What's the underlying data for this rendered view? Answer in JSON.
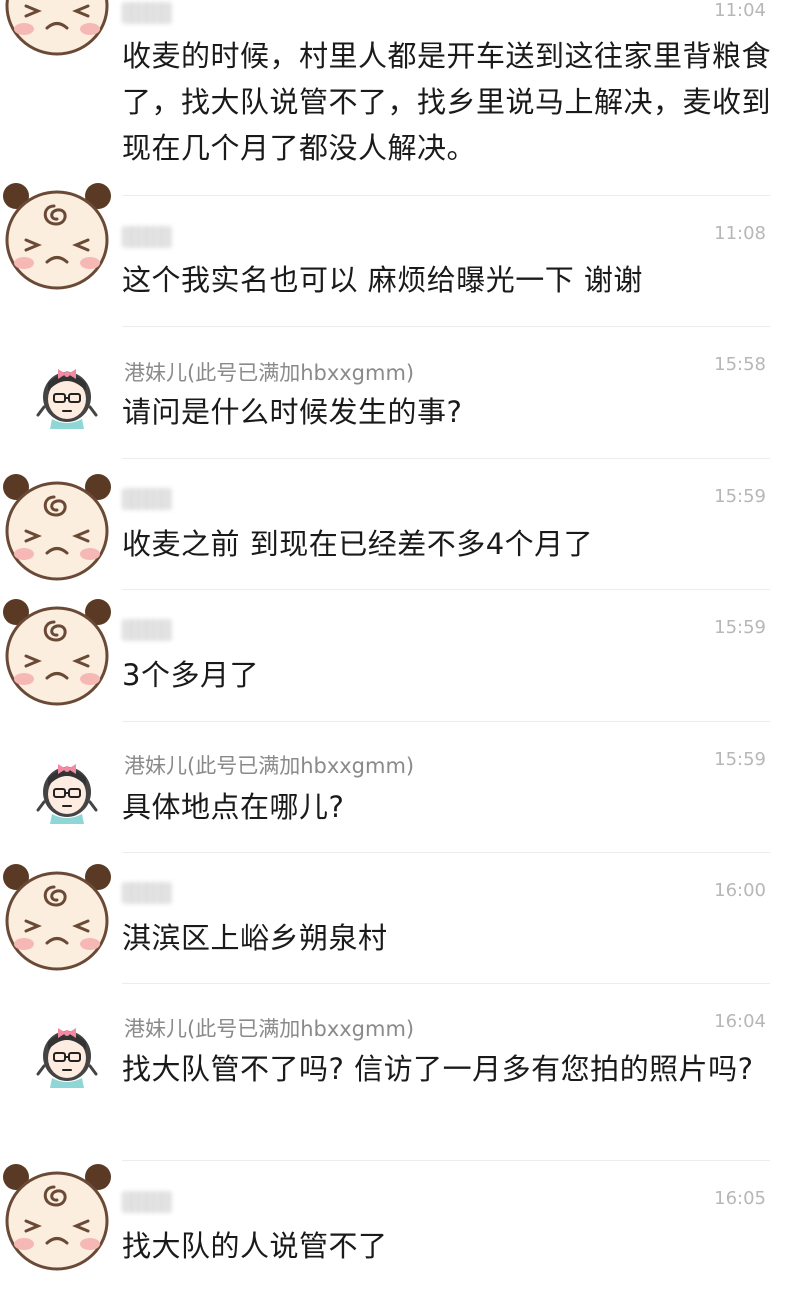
{
  "messages": [
    {
      "sender": "",
      "time": "11:04",
      "avatar": "bear-face-avatar",
      "text": "收麦的时候，村里人都是开车送到这往家里背粮食了，找大队说管不了，找乡里说马上解决，麦收到现在几个月了都没人解决。"
    },
    {
      "sender": "",
      "time": "11:08",
      "avatar": "bear-face-avatar",
      "text": "这个我实名也可以  麻烦给曝光一下 谢谢"
    },
    {
      "sender": "港妹儿(此号已满加hbxxgmm)",
      "time": "15:58",
      "avatar": "girl-avatar",
      "text": "请问是什么时候发生的事?"
    },
    {
      "sender": "",
      "time": "15:59",
      "avatar": "bear-face-avatar",
      "text": "收麦之前  到现在已经差不多4个月了"
    },
    {
      "sender": "",
      "time": "15:59",
      "avatar": "bear-face-avatar",
      "text": "3个多月了"
    },
    {
      "sender": "港妹儿(此号已满加hbxxgmm)",
      "time": "15:59",
      "avatar": "girl-avatar",
      "text": "具体地点在哪儿?"
    },
    {
      "sender": "",
      "time": "16:00",
      "avatar": "bear-face-avatar",
      "text": "淇滨区上峪乡朔泉村"
    },
    {
      "sender": "港妹儿(此号已满加hbxxgmm)",
      "time": "16:04",
      "avatar": "girl-avatar",
      "text": "找大队管不了吗? 信访了一月多有您拍的照片吗?"
    },
    {
      "sender": "",
      "time": "16:05",
      "avatar": "bear-face-avatar",
      "text": "找大队的人说管不了"
    }
  ]
}
